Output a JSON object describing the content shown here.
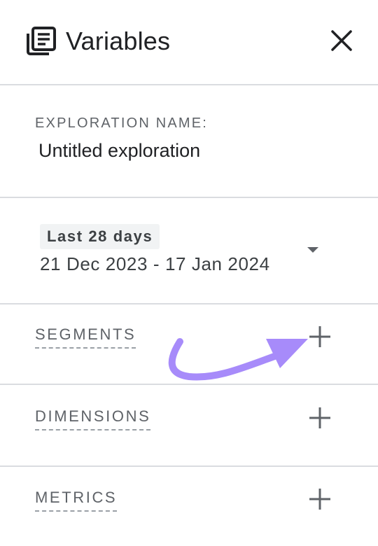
{
  "header": {
    "title": "Variables",
    "title_icon": "variables-list-icon",
    "close_icon": "close-icon"
  },
  "exploration": {
    "label": "EXPLORATION NAME:",
    "name": "Untitled exploration"
  },
  "date_range": {
    "preset": "Last 28 days",
    "range": "21 Dec 2023 - 17 Jan 2024",
    "dropdown_icon": "dropdown-arrow-icon"
  },
  "sections": {
    "segments": {
      "label": "SEGMENTS",
      "add_icon": "plus-icon"
    },
    "dimensions": {
      "label": "DIMENSIONS",
      "add_icon": "plus-icon"
    },
    "metrics": {
      "label": "METRICS",
      "add_icon": "plus-icon"
    }
  },
  "annotation": {
    "arrow_color": "#a78bfa",
    "arrow_icon": "curved-arrow-icon"
  },
  "colors": {
    "text_primary": "#202124",
    "text_secondary": "#5f6368",
    "divider": "#dadce0",
    "chip_bg": "#f1f3f4"
  }
}
